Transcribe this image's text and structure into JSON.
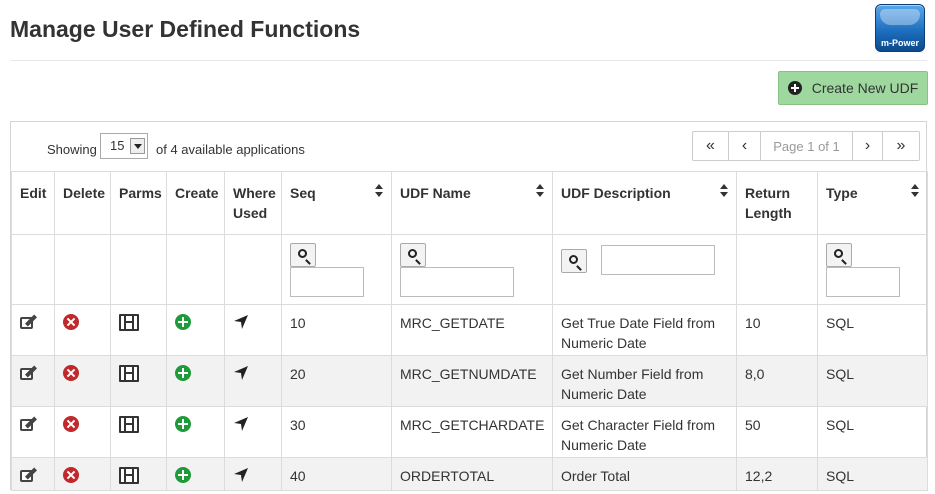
{
  "page": {
    "title": "Manage User Defined Functions",
    "logo_text": "m-Power",
    "create_button_label": "Create New UDF"
  },
  "toolbar": {
    "showing_label": "Showing",
    "page_size": "15",
    "available_text": "of 4 available applications",
    "pager": {
      "first": "«",
      "prev": "‹",
      "page_label": "Page 1 of 1",
      "next": "›",
      "last": "»"
    }
  },
  "columns": {
    "edit": "Edit",
    "delete": "Delete",
    "parms": "Parms",
    "create": "Create",
    "where_used": "Where Used",
    "seq": "Seq",
    "udf_name": "UDF Name",
    "udf_description": "UDF Description",
    "return_length": "Return Length",
    "type": "Type"
  },
  "rows": [
    {
      "seq": "10",
      "name": "MRC_GETDATE",
      "description": "Get True Date Field from Numeric Date",
      "return_length": "10",
      "type": "SQL"
    },
    {
      "seq": "20",
      "name": "MRC_GETNUMDATE",
      "description": "Get Number Field from Numeric Date",
      "return_length": "8,0",
      "type": "SQL"
    },
    {
      "seq": "30",
      "name": "MRC_GETCHARDATE",
      "description": "Get Character Field from Numeric Date",
      "return_length": "50",
      "type": "SQL"
    },
    {
      "seq": "40",
      "name": "ORDERTOTAL",
      "description": "Order Total",
      "return_length": "12,2",
      "type": "SQL"
    }
  ],
  "colors": {
    "create_button_bg": "#9fd89f",
    "delete_icon": "#c0282c",
    "create_icon": "#1f9a3a",
    "row_alt_bg": "#f2f2f2"
  },
  "icons": {
    "edit": "edit-icon",
    "delete": "delete-icon",
    "parms": "film-icon",
    "create": "create-icon",
    "where_used": "location-arrow-icon",
    "filter": "search-icon"
  }
}
